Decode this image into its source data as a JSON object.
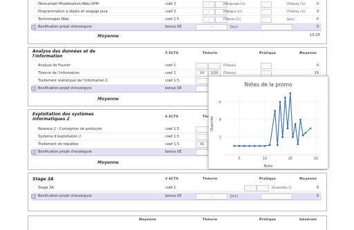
{
  "top_block": {
    "rows": [
      {
        "name": "Péné-projet Modélisation-Web-UHM",
        "coef": "coef 2",
        "inp": "-",
        "tag": "[Pénéprojet (1)]",
        "tag2": "[Théoriq. (1)]",
        "grade": "0"
      },
      {
        "name": "Programmation à objets et langage Java",
        "coef": "coef 2",
        "inp": "-",
        "tag": "[Pratique (1)]",
        "tag2": "[Théoriq. (1)]",
        "grade": "0"
      },
      {
        "name": "Technologies Web",
        "coef": "coef 1.5",
        "inp": "-",
        "tag": "[Théorie (1)]",
        "tag2": "[Jury]",
        "grade": "0"
      },
      {
        "name": "Bonification projet d'envergure",
        "coef": "bonus UE",
        "inp": "-",
        "tag": "[Jury]",
        "tag2": "",
        "grade": "0"
      }
    ],
    "moyenne_label": "Moyenne",
    "moyenne_value": "13.25"
  },
  "blocks": [
    {
      "title_l1": "Analyse des données et de",
      "title_l2": "l'information",
      "ects": "5 ECTS",
      "col_theorie": "Théorie",
      "col_pratique": "Pratique",
      "col_moyenne": "Moyenne",
      "rows": [
        {
          "name": "Analyse de Fourier",
          "coef": "coef 1",
          "v1": "",
          "v2": "",
          "tag": "[Théorie]",
          "grade": "0"
        },
        {
          "name": "Théorie de l'information",
          "coef": "coef 1",
          "v1": "19",
          "v2": "1/59",
          "tag": "[Théorie]",
          "grade": "19"
        },
        {
          "name": "Traitement statistique de l'information 2",
          "coef": "coef 1.5",
          "v1": "-",
          "v2": "",
          "tag": "",
          "grade": ""
        },
        {
          "name": "Bonification projet d'envergure",
          "coef": "bonus UE",
          "v1": "-",
          "v2": "",
          "tag": "",
          "grade": ""
        }
      ],
      "moyenne_label": "Moyenne"
    },
    {
      "title_l1": "Exploitation des systèmes",
      "title_l2": "informatiques 2",
      "ects": "6 ECTS",
      "col_theorie": "Théorie",
      "rows": [
        {
          "name": "Réseaux 2 - Conception de protocole",
          "coef": "coef 1.5",
          "v1": "-",
          "v2": "",
          "tag": "",
          "grade": ""
        },
        {
          "name": "Système d'exploitation 2",
          "coef": "coef 1.5",
          "v1": "-",
          "v2": "",
          "tag": "",
          "grade": ""
        },
        {
          "name": "Traitement de requêtes",
          "coef": "coef 1.5",
          "v1": "16",
          "v2": "2/6",
          "tag": "",
          "grade": ""
        },
        {
          "name": "Bonification projet d'envergure",
          "coef": "bonus UE",
          "v1": "-",
          "v2": "",
          "tag": "",
          "grade": ""
        }
      ],
      "moyenne_label": "Moyenne"
    },
    {
      "title_l1": "Stage 3A",
      "title_l2": "",
      "ects": "2 ECTS",
      "col_theorie": "Théorie",
      "col_pratique": "Pratique",
      "col_moyenne": "Moyenne",
      "rows": [
        {
          "name": "Stage 3A",
          "coef": "coef 1",
          "v1": "-",
          "v2": "",
          "tag": "[Évaluation 1]",
          "grade": "0"
        },
        {
          "name": "Bonification projet d'envergure",
          "coef": "bonus UE",
          "v1": "-",
          "v2": "",
          "tag": "[Jury]",
          "grade": "0"
        }
      ]
    }
  ],
  "footer_cols": [
    "Moyenne",
    "Théorie",
    "Pratique",
    "Générale"
  ],
  "chart_data": {
    "type": "line",
    "title": "Notes de la promo",
    "xlabel": "Note",
    "ylabel": "Quantité",
    "xlim": [
      2,
      21
    ],
    "ylim": [
      0,
      7
    ],
    "xticks": [
      5,
      10,
      15,
      20
    ],
    "yticks": [
      2,
      4,
      6
    ],
    "series": [
      {
        "color": "#1f5fc0",
        "x": [
          4,
          5,
          6,
          7,
          8,
          9,
          10,
          11,
          12,
          12.5,
          13,
          13.5,
          14,
          14.5,
          15,
          15.5,
          16,
          16.5,
          17,
          17.5,
          18
        ],
        "y": [
          1,
          1,
          1,
          1,
          1,
          1,
          1,
          1.1,
          5,
          1.1,
          6,
          2,
          6.5,
          3,
          7,
          2,
          3.5,
          1.2,
          4,
          2.2,
          2.5
        ]
      },
      {
        "color": "#3a9a3a",
        "x": [
          18,
          19
        ],
        "y": [
          2.5,
          3
        ]
      }
    ]
  }
}
